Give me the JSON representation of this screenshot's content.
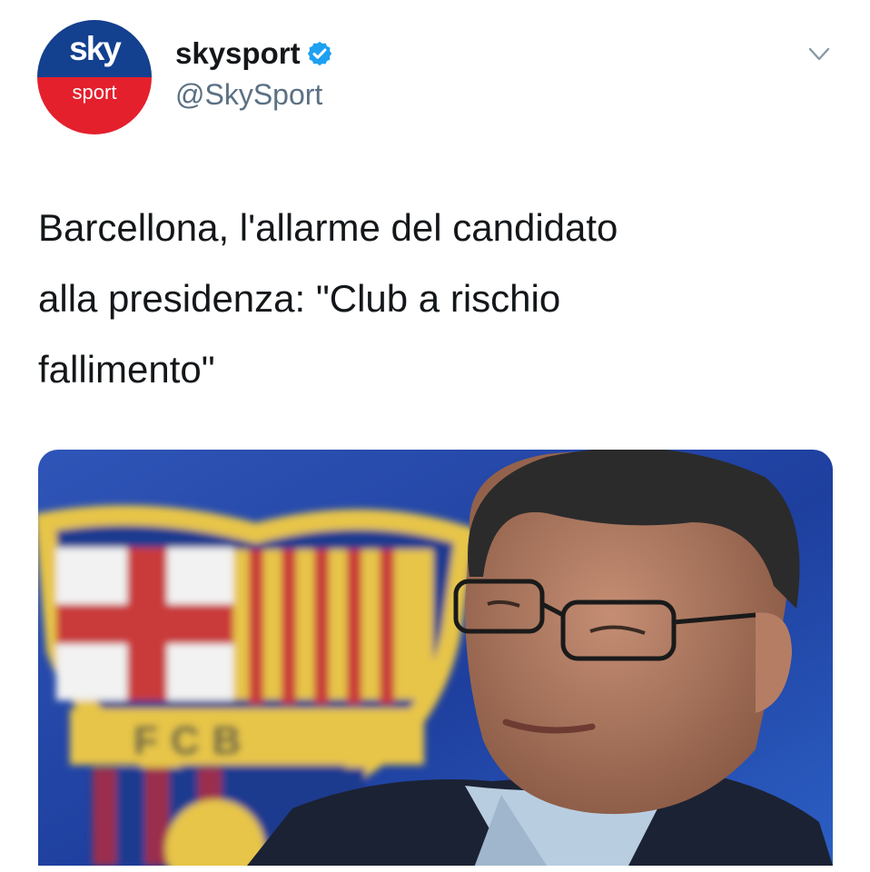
{
  "account": {
    "avatar_top_text": "sky",
    "avatar_bottom_text": "sport",
    "display_name": "skysport",
    "handle": "@SkySport",
    "verified": true
  },
  "tweet": {
    "text": "Barcellona, l'allarme del candidato\nalla presidenza: \"Club a rischio\nfallimento\""
  },
  "media": {
    "crest_letters": "FCB"
  },
  "colors": {
    "sky_blue": "#13408f",
    "sky_red": "#e4202d",
    "verified_blue": "#1da1f2",
    "handle_gray": "#5b7083",
    "text": "#14171a"
  },
  "icons": {
    "menu": "chevron-down-icon",
    "verified": "verified-badge-icon"
  }
}
